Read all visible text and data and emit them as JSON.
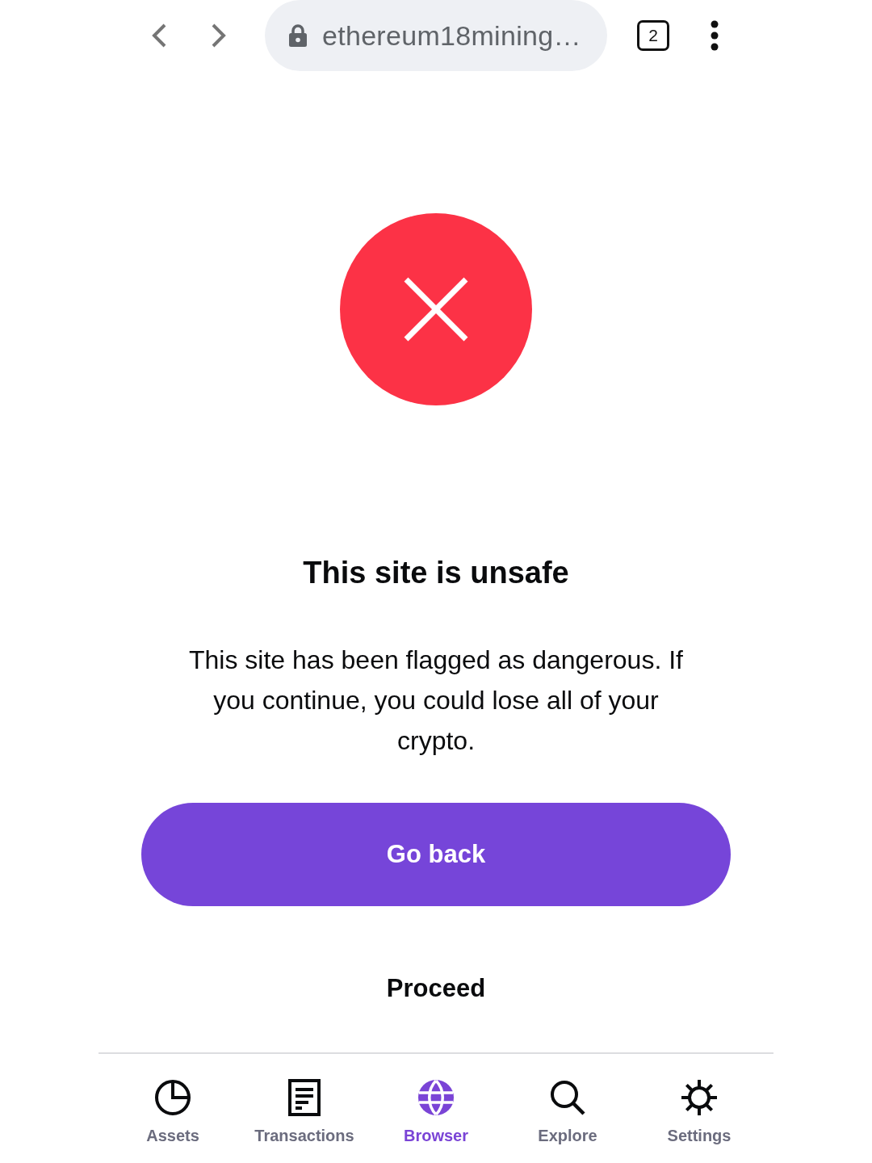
{
  "browser_bar": {
    "url": "ethereum18mining…",
    "tab_count": "2"
  },
  "warning": {
    "title": "This site is unsafe",
    "message": "This site has been flagged as dangerous. If you continue, you could lose all of your crypto.",
    "primary_button": "Go back",
    "secondary_button": "Proceed"
  },
  "nav": {
    "items": [
      {
        "label": "Assets",
        "kind": "pie",
        "selected": false
      },
      {
        "label": "Transactions",
        "kind": "document",
        "selected": false
      },
      {
        "label": "Browser",
        "kind": "globe",
        "selected": true
      },
      {
        "label": "Explore",
        "kind": "search",
        "selected": false
      },
      {
        "label": "Settings",
        "kind": "gear",
        "selected": false
      }
    ]
  }
}
